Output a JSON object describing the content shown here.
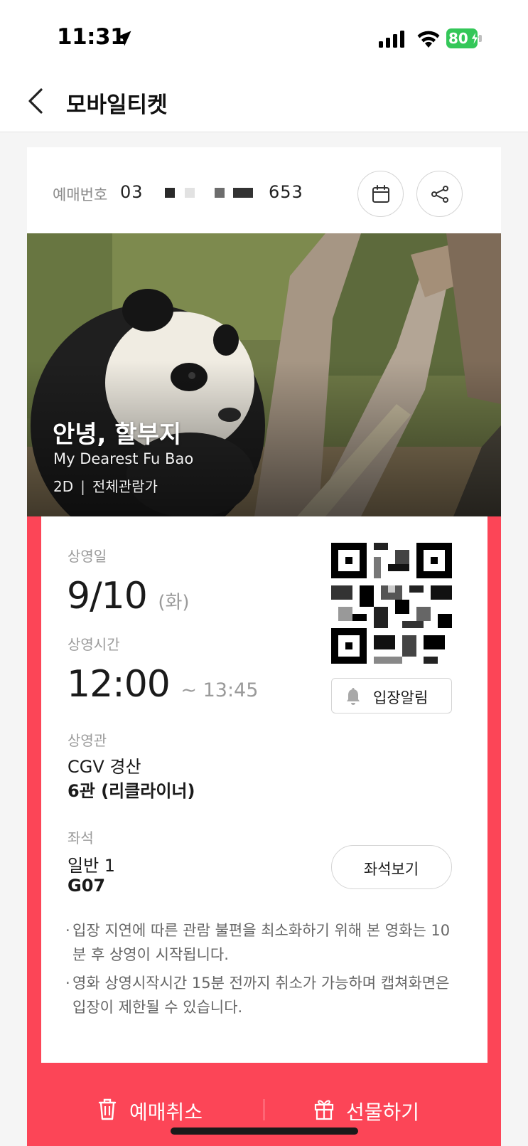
{
  "status_bar": {
    "time": "11:31",
    "battery": "80"
  },
  "header": {
    "title": "모바일티켓"
  },
  "reservation": {
    "label": "예매번호",
    "number_prefix": "03",
    "number_suffix": "653"
  },
  "movie": {
    "title": "안녕, 할부지",
    "english_title": "My Dearest Fu Bao",
    "format": "2D",
    "separator": "|",
    "rating": "전체관람가"
  },
  "screening": {
    "date_label": "상영일",
    "date": "9/10",
    "day": "(화)",
    "time_label": "상영시간",
    "start_time": "12:00",
    "end_time": "~ 13:45",
    "theater_label": "상영관",
    "theater_name": "CGV 경산",
    "hall": "6관 (리클라이너)",
    "seat_label": "좌석",
    "seat_type": "일반 1",
    "seat_number": "G07"
  },
  "buttons": {
    "entry_alarm": "입장알림",
    "view_seats": "좌석보기",
    "cancel": "예매취소",
    "gift": "선물하기"
  },
  "notices": [
    "입장 지연에 따른 관람 불편을 최소화하기 위해 본 영화는 10분 후 상영이 시작됩니다.",
    "영화 상영시작시간 15분 전까지 취소가 가능하며 캡쳐화면은 입장이 제한될 수 있습니다."
  ],
  "notice_bullet": "·",
  "icons": {
    "location": "location-arrow-icon",
    "signal": "cellular-signal-icon",
    "wifi": "wifi-icon",
    "battery": "battery-charging-icon",
    "back": "chevron-left-icon",
    "calendar": "calendar-icon",
    "share": "share-icon",
    "bell": "bell-icon",
    "trash": "trash-icon",
    "gift": "gift-icon"
  },
  "colors": {
    "accent": "#fc4557",
    "battery": "#34c759",
    "muted_text": "#9a9a9a"
  }
}
